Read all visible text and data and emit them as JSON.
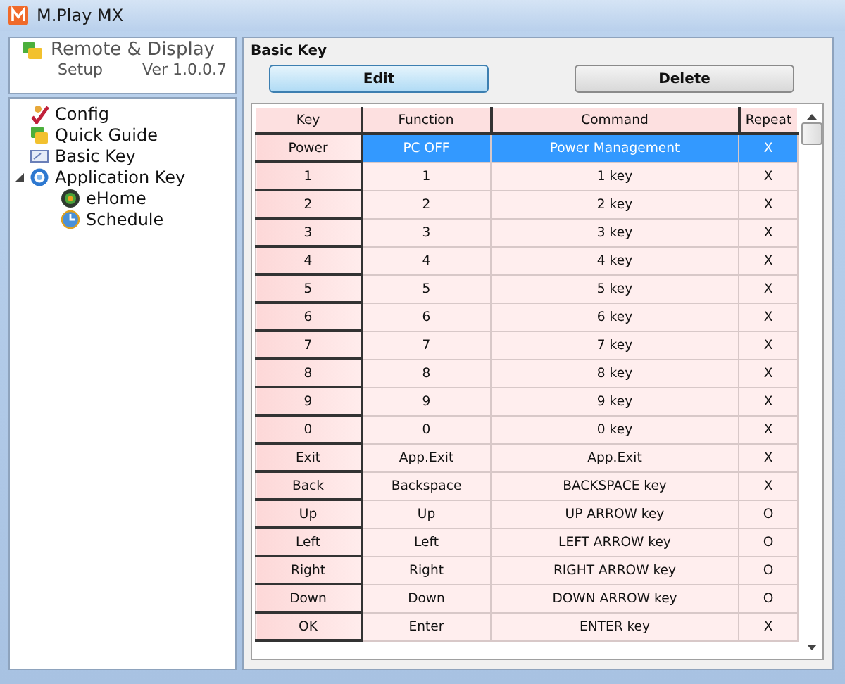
{
  "window": {
    "title": "M.Play MX"
  },
  "sidebar": {
    "app_name": "Remote & Display",
    "subtitle": "Setup",
    "version": "Ver 1.0.0.7",
    "tree": [
      {
        "label": "Config"
      },
      {
        "label": "Quick Guide"
      },
      {
        "label": "Basic Key"
      },
      {
        "label": "Application Key",
        "expanded": true,
        "children": [
          {
            "label": "eHome"
          },
          {
            "label": "Schedule"
          }
        ]
      }
    ]
  },
  "panel": {
    "title": "Basic Key",
    "buttons": [
      {
        "label": "Edit",
        "kind": "primary"
      },
      {
        "label": "Delete",
        "kind": "normal"
      }
    ]
  },
  "table": {
    "columns": [
      "Key",
      "Function",
      "Command",
      "Repeat"
    ],
    "rows": [
      {
        "cells": [
          "Power",
          "PC OFF",
          "Power Management",
          "X"
        ],
        "selected": true
      },
      {
        "cells": [
          "1",
          "1",
          "1 key",
          "X"
        ],
        "selected": false
      },
      {
        "cells": [
          "2",
          "2",
          "2 key",
          "X"
        ],
        "selected": false
      },
      {
        "cells": [
          "3",
          "3",
          "3 key",
          "X"
        ],
        "selected": false
      },
      {
        "cells": [
          "4",
          "4",
          "4 key",
          "X"
        ],
        "selected": false
      },
      {
        "cells": [
          "5",
          "5",
          "5 key",
          "X"
        ],
        "selected": false
      },
      {
        "cells": [
          "6",
          "6",
          "6 key",
          "X"
        ],
        "selected": false
      },
      {
        "cells": [
          "7",
          "7",
          "7 key",
          "X"
        ],
        "selected": false
      },
      {
        "cells": [
          "8",
          "8",
          "8 key",
          "X"
        ],
        "selected": false
      },
      {
        "cells": [
          "9",
          "9",
          "9 key",
          "X"
        ],
        "selected": false
      },
      {
        "cells": [
          "0",
          "0",
          "0 key",
          "X"
        ],
        "selected": false
      },
      {
        "cells": [
          "Exit",
          "App.Exit",
          "App.Exit",
          "X"
        ],
        "selected": false
      },
      {
        "cells": [
          "Back",
          "Backspace",
          "BACKSPACE key",
          "X"
        ],
        "selected": false
      },
      {
        "cells": [
          "Up",
          "Up",
          "UP ARROW key",
          "O"
        ],
        "selected": false
      },
      {
        "cells": [
          "Left",
          "Left",
          "LEFT ARROW key",
          "O"
        ],
        "selected": false
      },
      {
        "cells": [
          "Right",
          "Right",
          "RIGHT ARROW key",
          "O"
        ],
        "selected": false
      },
      {
        "cells": [
          "Down",
          "Down",
          "DOWN ARROW key",
          "O"
        ],
        "selected": false
      },
      {
        "cells": [
          "OK",
          "Enter",
          "ENTER key",
          "X"
        ],
        "selected": false
      }
    ]
  }
}
